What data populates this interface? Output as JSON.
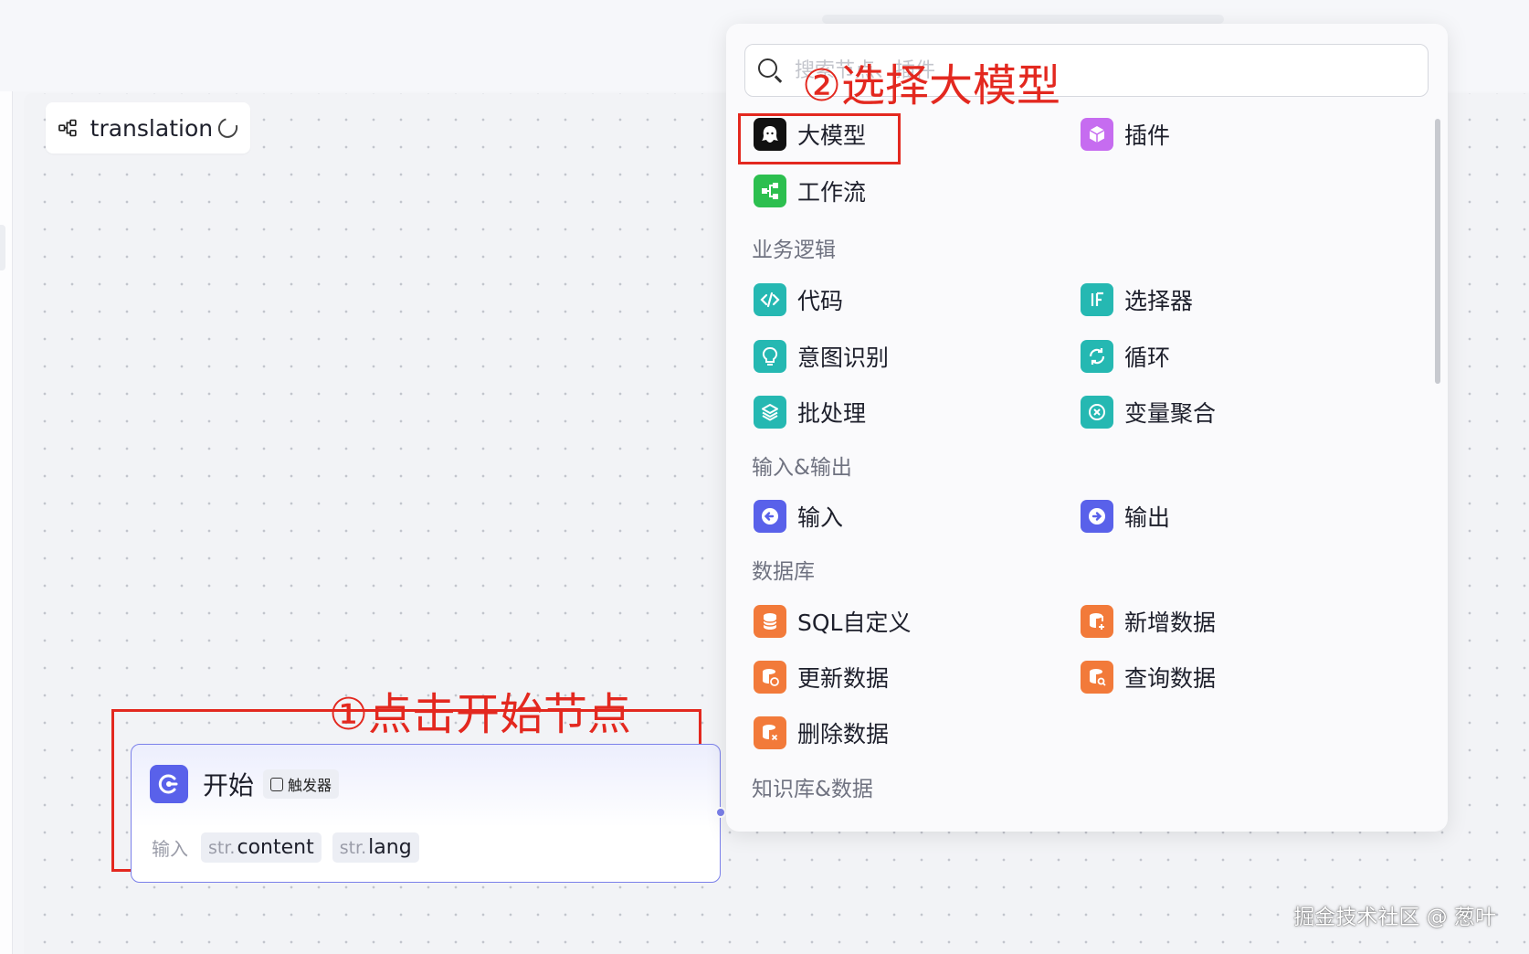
{
  "workflow": {
    "name": "translation"
  },
  "start_node": {
    "title": "开始",
    "badge": "触发器",
    "input_label": "输入",
    "params": [
      {
        "type": "str.",
        "name": "content"
      },
      {
        "type": "str.",
        "name": "lang"
      }
    ]
  },
  "annotations": {
    "step1": "①点击开始节点",
    "step2": "②选择大模型"
  },
  "panel": {
    "search_placeholder": "搜索节点、插件",
    "top_items": [
      {
        "label": "大模型",
        "icon": "llm-icon",
        "color": "#111111"
      },
      {
        "label": "插件",
        "icon": "plugin-cube-icon",
        "color": "#c66cf0"
      },
      {
        "label": "工作流",
        "icon": "workflow-icon",
        "color": "#2cbf4f"
      }
    ],
    "sections": [
      {
        "title": "业务逻辑",
        "items": [
          {
            "label": "代码",
            "icon": "code-icon",
            "color": "#25b8b2"
          },
          {
            "label": "选择器",
            "icon": "if-icon",
            "color": "#25b8b2"
          },
          {
            "label": "意图识别",
            "icon": "bulb-icon",
            "color": "#25b8b2"
          },
          {
            "label": "循环",
            "icon": "loop-icon",
            "color": "#25b8b2"
          },
          {
            "label": "批处理",
            "icon": "layers-icon",
            "color": "#25b8b2"
          },
          {
            "label": "变量聚合",
            "icon": "aggregate-icon",
            "color": "#25b8b2"
          }
        ]
      },
      {
        "title": "输入&输出",
        "items": [
          {
            "label": "输入",
            "icon": "input-arrow-icon",
            "color": "#5961ea"
          },
          {
            "label": "输出",
            "icon": "output-arrow-icon",
            "color": "#5961ea"
          }
        ]
      },
      {
        "title": "数据库",
        "items": [
          {
            "label": "SQL自定义",
            "icon": "database-icon",
            "color": "#f27a3a"
          },
          {
            "label": "新增数据",
            "icon": "database-add-icon",
            "color": "#f27a3a"
          },
          {
            "label": "更新数据",
            "icon": "database-update-icon",
            "color": "#f27a3a"
          },
          {
            "label": "查询数据",
            "icon": "database-search-icon",
            "color": "#f27a3a"
          },
          {
            "label": "删除数据",
            "icon": "database-delete-icon",
            "color": "#f27a3a"
          }
        ]
      },
      {
        "title": "知识库&数据",
        "items": []
      }
    ]
  },
  "watermark": "掘金技术社区 @ 葱叶"
}
